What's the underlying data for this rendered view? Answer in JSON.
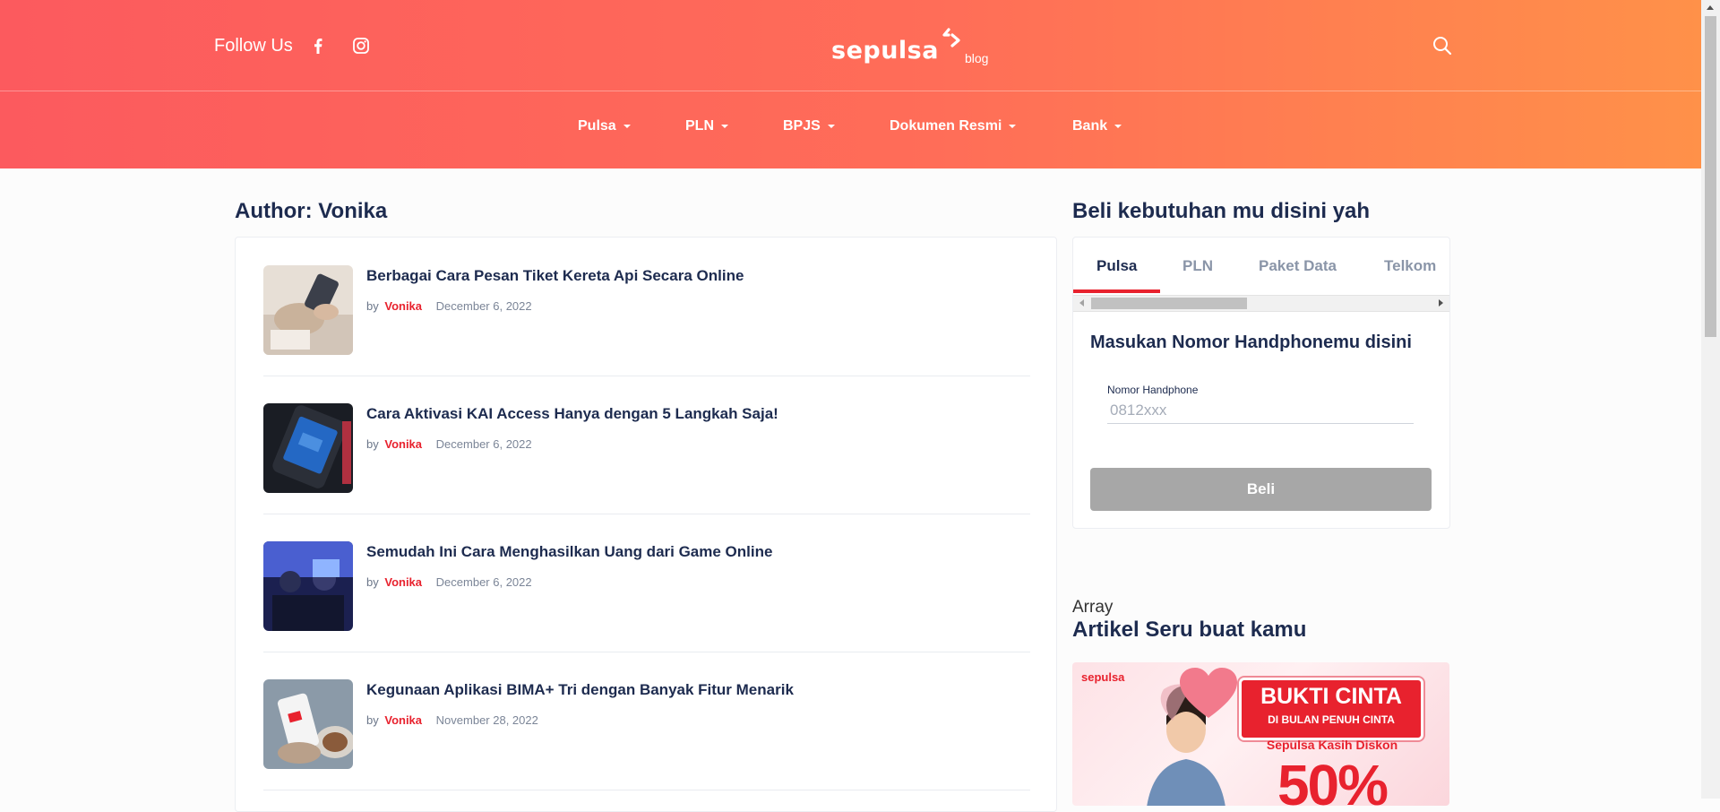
{
  "header": {
    "follow_label": "Follow Us",
    "social_icons": [
      "facebook-icon",
      "instagram-icon"
    ],
    "logo_text": "sepulsa",
    "logo_sub": "blog",
    "search_icon": "search-icon",
    "gradient_colors": [
      "#fc5a5e",
      "#ff9149"
    ]
  },
  "nav": {
    "items": [
      {
        "label": "Pulsa"
      },
      {
        "label": "PLN"
      },
      {
        "label": "BPJS"
      },
      {
        "label": "Dokumen Resmi"
      },
      {
        "label": "Bank"
      }
    ]
  },
  "main": {
    "page_title": "Author: Vonika",
    "by_label": "by",
    "posts": [
      {
        "title": "Berbagai Cara Pesan Tiket Kereta Api Secara Online",
        "author": "Vonika",
        "date": "December 6, 2022"
      },
      {
        "title": "Cara Aktivasi KAI Access Hanya dengan 5 Langkah Saja!",
        "author": "Vonika",
        "date": "December 6, 2022"
      },
      {
        "title": "Semudah Ini Cara Menghasilkan Uang dari Game Online",
        "author": "Vonika",
        "date": "December 6, 2022"
      },
      {
        "title": "Kegunaan Aplikasi BIMA+ Tri dengan Banyak Fitur Menarik",
        "author": "Vonika",
        "date": "November 28, 2022"
      }
    ]
  },
  "sidebar": {
    "widget_title": "Beli kebutuhan mu disini yah",
    "tabs": [
      {
        "label": "Pulsa"
      },
      {
        "label": "PLN"
      },
      {
        "label": "Paket Data"
      },
      {
        "label": "Telkom"
      }
    ],
    "active_tab": "Pulsa",
    "form_title": "Masukan Nomor Handphonemu disini",
    "field_label": "Nomor Handphone",
    "field_placeholder": "0812xxx",
    "buy_label": "Beli",
    "array_text": "Array",
    "artikel_title": "Artikel Seru buat kamu",
    "promo": {
      "brand": "sepulsa",
      "headline": "BUKTI CINTA",
      "sub": "DI BULAN PENUH CINTA",
      "discount_label": "Sepulsa Kasih Diskon",
      "percent": "50%"
    }
  },
  "colors": {
    "accent": "#e8222e",
    "text_dark": "#1d2b4f",
    "buy_button": "#a7a7a7"
  }
}
